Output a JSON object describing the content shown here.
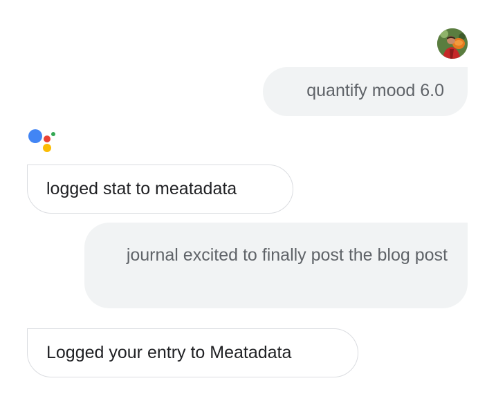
{
  "conversation": {
    "messages": [
      {
        "role": "user",
        "text": "quantify mood 6.0"
      },
      {
        "role": "assistant",
        "text": "logged stat to meatadata"
      },
      {
        "role": "user",
        "text": "journal excited to finally post the blog post"
      },
      {
        "role": "assistant",
        "text": "Logged your entry to Meatadata"
      }
    ]
  },
  "icons": {
    "user_avatar": "user-avatar",
    "assistant_logo": "google-assistant-icon"
  },
  "colors": {
    "user_bubble_bg": "#f1f3f4",
    "user_text": "#5f6368",
    "assistant_text": "#202124",
    "assistant_border": "#dadce0",
    "assistant_blue": "#4285f4",
    "assistant_red": "#ea4335",
    "assistant_yellow": "#fbbc05",
    "assistant_green": "#34a853"
  }
}
